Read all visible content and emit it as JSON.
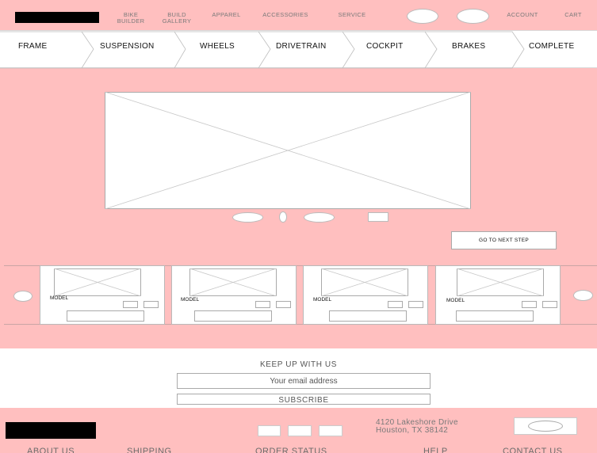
{
  "header": {
    "nav": [
      {
        "label_line1": "BIKE",
        "label_line2": "BUILDER"
      },
      {
        "label_line1": "BUILD",
        "label_line2": "GALLERY"
      },
      {
        "label_line1": "APPAREL",
        "label_line2": ""
      },
      {
        "label_line1": "ACCESSORIES",
        "label_line2": ""
      },
      {
        "label_line1": "SERVICE",
        "label_line2": ""
      }
    ],
    "account_label": "ACCOUNT",
    "cart_label": "CART"
  },
  "steps": [
    "FRAME",
    "SUSPENSION",
    "WHEELS",
    "DRIVETRAIN",
    "COCKPIT",
    "BRAKES",
    "COMPLETE"
  ],
  "next_step_label": "GO TO NEXT STEP",
  "carousel": {
    "cards": [
      {
        "model": "MODEL"
      },
      {
        "model": "MODEL"
      },
      {
        "model": "MODEL"
      },
      {
        "model": "MODEL"
      }
    ]
  },
  "newsletter": {
    "title": "KEEP UP WITH US",
    "email_placeholder": "Your email address",
    "subscribe_label": "SUBSCRIBE"
  },
  "footer": {
    "address_line1": "4120 Lakeshore Drive",
    "address_line2": "Houston, TX 38142",
    "links": [
      "ABOUT US",
      "SHIPPING",
      "ORDER STATUS",
      "HELP",
      "CONTACT US"
    ]
  },
  "colors": {
    "background": "#ffbfbf",
    "panel": "#ffffff",
    "logo": "#000000"
  }
}
